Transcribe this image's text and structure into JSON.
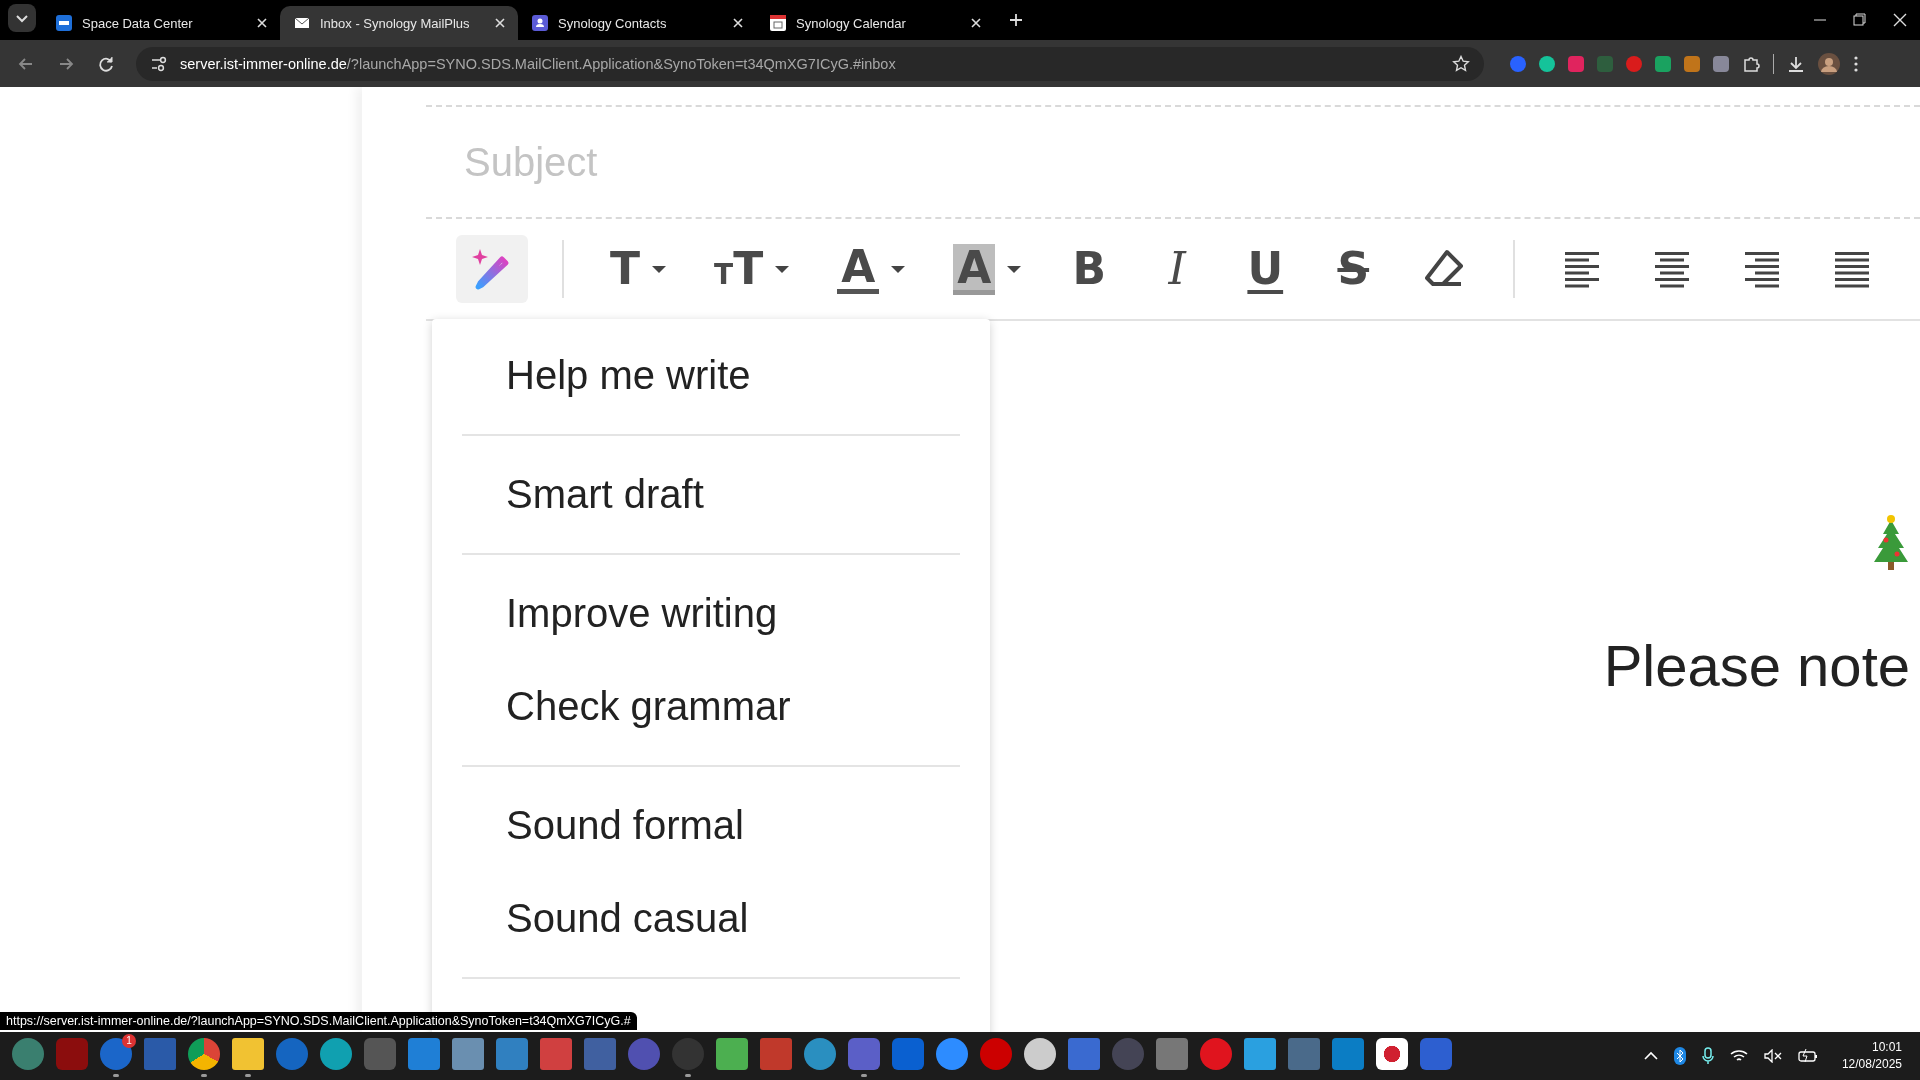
{
  "browser": {
    "tabs": [
      {
        "title": "Space Data Center",
        "kind": "dsm",
        "selected": false
      },
      {
        "title": "Inbox - Synology MailPlus",
        "kind": "mail",
        "selected": true
      },
      {
        "title": "Synology Contacts",
        "kind": "contacts",
        "selected": false
      },
      {
        "title": "Synology Calendar",
        "kind": "calendar",
        "selected": false
      }
    ],
    "url_host": "server.ist-immer-online.de",
    "url_rest": "/?launchApp=SYNO.SDS.MailClient.Application&SynoToken=t34QmXG7ICyG.#inbox",
    "extensions": [
      {
        "kind": "iq"
      },
      {
        "kind": "grammar"
      },
      {
        "kind": "abp"
      },
      {
        "kind": "download"
      },
      {
        "kind": "hand"
      },
      {
        "kind": "play"
      },
      {
        "kind": "book"
      },
      {
        "kind": "photo"
      }
    ],
    "status_url": "https://server.ist-immer-online.de/?launchApp=SYNO.SDS.MailClient.Application&SynoToken=t34QmXG7ICyG.#"
  },
  "compose": {
    "subject": {
      "placeholder": "Subject"
    },
    "toolbar": [
      {
        "kind": "ai",
        "active": true
      },
      {
        "kind": "divider"
      },
      {
        "kind": "text",
        "glyph": "T",
        "dropdown": true
      },
      {
        "kind": "size",
        "glyph": "T",
        "small_glyph": "T",
        "dropdown": true
      },
      {
        "kind": "color",
        "glyph": "A",
        "dropdown": true
      },
      {
        "kind": "bgcolor",
        "glyph": "A",
        "dropdown": true
      },
      {
        "kind": "bold",
        "glyph": "B"
      },
      {
        "kind": "italic",
        "glyph": "I"
      },
      {
        "kind": "underline",
        "glyph": "U"
      },
      {
        "kind": "strike",
        "glyph": "S"
      },
      {
        "kind": "eraser"
      },
      {
        "kind": "divider"
      },
      {
        "kind": "align-left"
      },
      {
        "kind": "align-center"
      },
      {
        "kind": "align-right"
      },
      {
        "kind": "justify"
      }
    ],
    "ai_menu": [
      {
        "label": "Help me write",
        "divider_after": true
      },
      {
        "label": "Smart draft",
        "divider_after": true
      },
      {
        "label": "Improve writing",
        "divider_after": false
      },
      {
        "label": "Check grammar",
        "divider_after": true
      },
      {
        "label": "Sound formal",
        "divider_after": false
      },
      {
        "label": "Sound casual",
        "divider_after": true
      }
    ],
    "body_text": "Please note"
  },
  "taskbar": {
    "apps": [
      {
        "kind": "shell",
        "running": false
      },
      {
        "kind": "shield",
        "running": false
      },
      {
        "kind": "mail",
        "running": true,
        "badge": "1"
      },
      {
        "kind": "window",
        "running": false
      },
      {
        "kind": "chrome",
        "running": true
      },
      {
        "kind": "folder",
        "running": true
      },
      {
        "kind": "search",
        "running": false
      },
      {
        "kind": "search2",
        "running": false
      },
      {
        "kind": "keys",
        "running": false
      },
      {
        "kind": "tiles",
        "running": false
      },
      {
        "kind": "panel",
        "running": false
      },
      {
        "kind": "network",
        "running": false
      },
      {
        "kind": "scissors",
        "running": false
      },
      {
        "kind": "doc",
        "running": false
      },
      {
        "kind": "globe",
        "running": false
      },
      {
        "kind": "obs",
        "running": true
      },
      {
        "kind": "green",
        "running": false
      },
      {
        "kind": "calc2",
        "running": false
      },
      {
        "kind": "circle",
        "running": false
      },
      {
        "kind": "teams",
        "running": true
      },
      {
        "kind": "u",
        "running": false
      },
      {
        "kind": "zoom",
        "running": false
      },
      {
        "kind": "record",
        "running": false
      },
      {
        "kind": "clock",
        "running": false
      },
      {
        "kind": "net2",
        "running": false
      },
      {
        "kind": "cam",
        "running": false
      },
      {
        "kind": "mic",
        "running": false
      },
      {
        "kind": "opera",
        "running": false
      },
      {
        "kind": "photos",
        "running": false
      },
      {
        "kind": "calc",
        "running": false
      },
      {
        "kind": "bars",
        "running": false
      },
      {
        "kind": "red",
        "running": false
      },
      {
        "kind": "blue",
        "running": false
      }
    ],
    "time": "10:01",
    "date": "12/08/2025"
  }
}
